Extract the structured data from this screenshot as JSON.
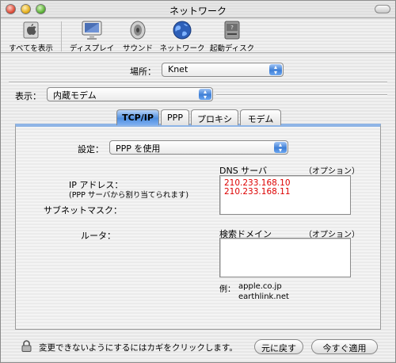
{
  "window": {
    "title": "ネットワーク"
  },
  "toolbar": {
    "items": [
      {
        "label": "すべてを表示",
        "icon": "apple-icon"
      },
      {
        "label": "ディスプレイ",
        "icon": "display-icon"
      },
      {
        "label": "サウンド",
        "icon": "speaker-icon"
      },
      {
        "label": "ネットワーク",
        "icon": "globe-icon"
      },
      {
        "label": "起動ディスク",
        "icon": "disk-icon"
      }
    ]
  },
  "location": {
    "label": "場所：",
    "value": "Knet"
  },
  "show": {
    "label": "表示：",
    "value": "内蔵モデム"
  },
  "tabs": [
    {
      "label": "TCP/IP",
      "active": true
    },
    {
      "label": "PPP",
      "active": false
    },
    {
      "label": "プロキシ",
      "active": false
    },
    {
      "label": "モデム",
      "active": false
    }
  ],
  "tcpip": {
    "configure_label": "設定：",
    "configure_value": "PPP を使用",
    "ip_label": "IP アドレス：",
    "ip_note": "(PPP サーバから割り当てられます)",
    "subnet_label": "サブネットマスク：",
    "router_label": "ルータ：",
    "dns_label": "DNS サーバ",
    "dns_optional": "（オプション）",
    "dns_servers": [
      "210.233.168.10",
      "210.233.168.11"
    ],
    "search_label": "検索ドメイン",
    "search_optional": "（オプション）",
    "example_label": "例：",
    "example_1": "apple.co.jp",
    "example_2": "earthlink.net"
  },
  "footer": {
    "lock_text": "変更できないようにするにはカギをクリックします。",
    "revert_label": "元に戻す",
    "apply_label": "今すぐ適用"
  },
  "colors": {
    "accent": "#3f7fd6",
    "dns_text": "#dd0000"
  }
}
